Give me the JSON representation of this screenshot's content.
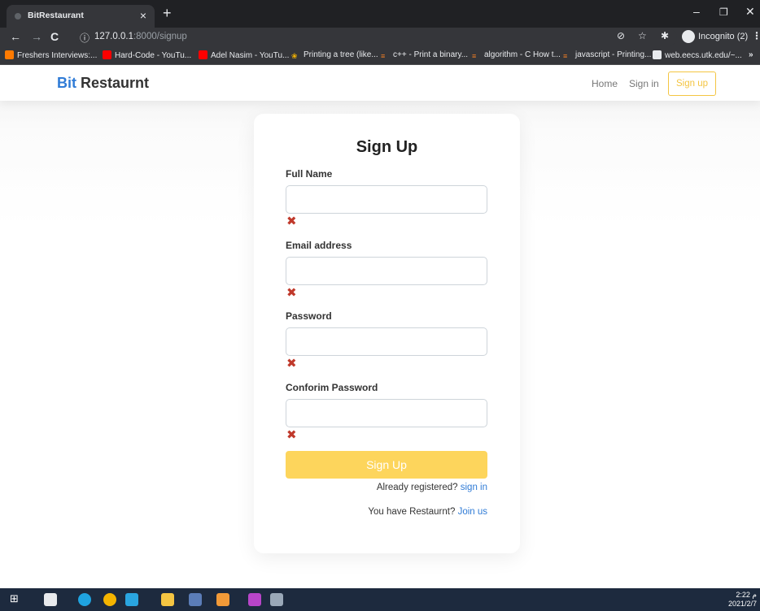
{
  "browser": {
    "tab_title": "BitRestaurant",
    "tab_close": "×",
    "new_tab": "+",
    "url_host": "127.0.0.1",
    "url_path": ":8000/signup",
    "incognito_label": "Incognito (2)",
    "window_controls": [
      "–",
      "❐",
      "✕"
    ],
    "bookmarks": [
      {
        "label": "Freshers Interviews:...",
        "icon": "blogger-icon"
      },
      {
        "label": "Hard-Code - YouTu...",
        "icon": "youtube-icon"
      },
      {
        "label": "Adel Nasim - YouTu...",
        "icon": "youtube-icon"
      },
      {
        "label": "Printing a tree (like...",
        "icon": "tree-icon"
      },
      {
        "label": "c++ - Print a binary...",
        "icon": "stackoverflow-icon"
      },
      {
        "label": "algorithm - C How t...",
        "icon": "stackoverflow-icon"
      },
      {
        "label": "javascript - Printing...",
        "icon": "stackoverflow-icon"
      },
      {
        "label": "web.eecs.utk.edu/~...",
        "icon": "globe-icon"
      }
    ],
    "bookmarks_overflow": "»"
  },
  "navbar": {
    "brand_prefix": "Bit",
    "brand_suffix": " Restaurnt",
    "links": {
      "home": "Home",
      "signin": "Sign in",
      "signup": "Sign up"
    }
  },
  "form": {
    "title": "Sign Up",
    "fields": {
      "full_name": {
        "label": "Full Name",
        "value": ""
      },
      "email": {
        "label": "Email address",
        "value": ""
      },
      "password": {
        "label": "Password",
        "value": ""
      },
      "confirm": {
        "label": "Conforim Password",
        "value": ""
      }
    },
    "error_mark": "✖",
    "submit_label": "Sign Up",
    "registered_text": "Already registered? ",
    "registered_link": "sign in",
    "restaurant_text": "You have Restaurnt? ",
    "restaurant_link": "Join us"
  },
  "taskbar": {
    "time": "2:22 م",
    "date": "2021/2/7"
  },
  "colors": {
    "accent_yellow": "#fdd55c",
    "brand_blue": "#2f7bd6",
    "error_red": "#c0392b",
    "taskbar": "#1d2a3e"
  }
}
